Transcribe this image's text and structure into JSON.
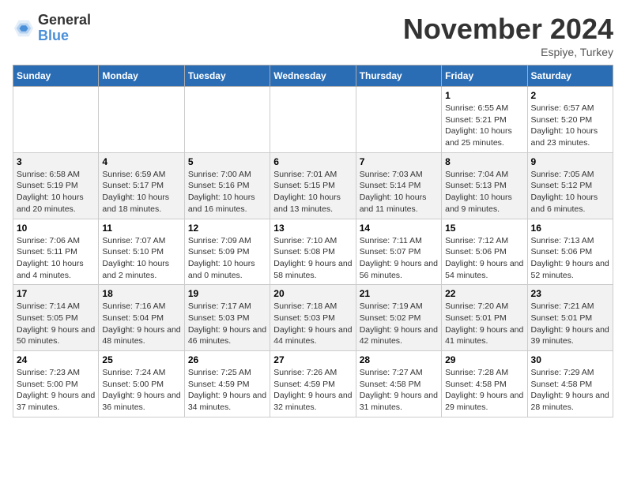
{
  "header": {
    "logo_general": "General",
    "logo_blue": "Blue",
    "month_title": "November 2024",
    "subtitle": "Espiye, Turkey"
  },
  "weekdays": [
    "Sunday",
    "Monday",
    "Tuesday",
    "Wednesday",
    "Thursday",
    "Friday",
    "Saturday"
  ],
  "weeks": [
    [
      {
        "day": "",
        "info": ""
      },
      {
        "day": "",
        "info": ""
      },
      {
        "day": "",
        "info": ""
      },
      {
        "day": "",
        "info": ""
      },
      {
        "day": "",
        "info": ""
      },
      {
        "day": "1",
        "info": "Sunrise: 6:55 AM\nSunset: 5:21 PM\nDaylight: 10 hours and 25 minutes."
      },
      {
        "day": "2",
        "info": "Sunrise: 6:57 AM\nSunset: 5:20 PM\nDaylight: 10 hours and 23 minutes."
      }
    ],
    [
      {
        "day": "3",
        "info": "Sunrise: 6:58 AM\nSunset: 5:19 PM\nDaylight: 10 hours and 20 minutes."
      },
      {
        "day": "4",
        "info": "Sunrise: 6:59 AM\nSunset: 5:17 PM\nDaylight: 10 hours and 18 minutes."
      },
      {
        "day": "5",
        "info": "Sunrise: 7:00 AM\nSunset: 5:16 PM\nDaylight: 10 hours and 16 minutes."
      },
      {
        "day": "6",
        "info": "Sunrise: 7:01 AM\nSunset: 5:15 PM\nDaylight: 10 hours and 13 minutes."
      },
      {
        "day": "7",
        "info": "Sunrise: 7:03 AM\nSunset: 5:14 PM\nDaylight: 10 hours and 11 minutes."
      },
      {
        "day": "8",
        "info": "Sunrise: 7:04 AM\nSunset: 5:13 PM\nDaylight: 10 hours and 9 minutes."
      },
      {
        "day": "9",
        "info": "Sunrise: 7:05 AM\nSunset: 5:12 PM\nDaylight: 10 hours and 6 minutes."
      }
    ],
    [
      {
        "day": "10",
        "info": "Sunrise: 7:06 AM\nSunset: 5:11 PM\nDaylight: 10 hours and 4 minutes."
      },
      {
        "day": "11",
        "info": "Sunrise: 7:07 AM\nSunset: 5:10 PM\nDaylight: 10 hours and 2 minutes."
      },
      {
        "day": "12",
        "info": "Sunrise: 7:09 AM\nSunset: 5:09 PM\nDaylight: 10 hours and 0 minutes."
      },
      {
        "day": "13",
        "info": "Sunrise: 7:10 AM\nSunset: 5:08 PM\nDaylight: 9 hours and 58 minutes."
      },
      {
        "day": "14",
        "info": "Sunrise: 7:11 AM\nSunset: 5:07 PM\nDaylight: 9 hours and 56 minutes."
      },
      {
        "day": "15",
        "info": "Sunrise: 7:12 AM\nSunset: 5:06 PM\nDaylight: 9 hours and 54 minutes."
      },
      {
        "day": "16",
        "info": "Sunrise: 7:13 AM\nSunset: 5:06 PM\nDaylight: 9 hours and 52 minutes."
      }
    ],
    [
      {
        "day": "17",
        "info": "Sunrise: 7:14 AM\nSunset: 5:05 PM\nDaylight: 9 hours and 50 minutes."
      },
      {
        "day": "18",
        "info": "Sunrise: 7:16 AM\nSunset: 5:04 PM\nDaylight: 9 hours and 48 minutes."
      },
      {
        "day": "19",
        "info": "Sunrise: 7:17 AM\nSunset: 5:03 PM\nDaylight: 9 hours and 46 minutes."
      },
      {
        "day": "20",
        "info": "Sunrise: 7:18 AM\nSunset: 5:03 PM\nDaylight: 9 hours and 44 minutes."
      },
      {
        "day": "21",
        "info": "Sunrise: 7:19 AM\nSunset: 5:02 PM\nDaylight: 9 hours and 42 minutes."
      },
      {
        "day": "22",
        "info": "Sunrise: 7:20 AM\nSunset: 5:01 PM\nDaylight: 9 hours and 41 minutes."
      },
      {
        "day": "23",
        "info": "Sunrise: 7:21 AM\nSunset: 5:01 PM\nDaylight: 9 hours and 39 minutes."
      }
    ],
    [
      {
        "day": "24",
        "info": "Sunrise: 7:23 AM\nSunset: 5:00 PM\nDaylight: 9 hours and 37 minutes."
      },
      {
        "day": "25",
        "info": "Sunrise: 7:24 AM\nSunset: 5:00 PM\nDaylight: 9 hours and 36 minutes."
      },
      {
        "day": "26",
        "info": "Sunrise: 7:25 AM\nSunset: 4:59 PM\nDaylight: 9 hours and 34 minutes."
      },
      {
        "day": "27",
        "info": "Sunrise: 7:26 AM\nSunset: 4:59 PM\nDaylight: 9 hours and 32 minutes."
      },
      {
        "day": "28",
        "info": "Sunrise: 7:27 AM\nSunset: 4:58 PM\nDaylight: 9 hours and 31 minutes."
      },
      {
        "day": "29",
        "info": "Sunrise: 7:28 AM\nSunset: 4:58 PM\nDaylight: 9 hours and 29 minutes."
      },
      {
        "day": "30",
        "info": "Sunrise: 7:29 AM\nSunset: 4:58 PM\nDaylight: 9 hours and 28 minutes."
      }
    ]
  ]
}
